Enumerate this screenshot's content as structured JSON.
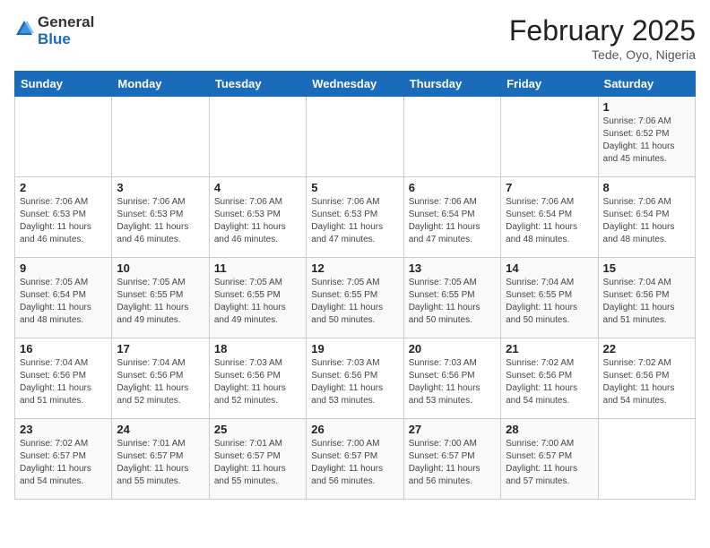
{
  "header": {
    "logo_general": "General",
    "logo_blue": "Blue",
    "month": "February 2025",
    "location": "Tede, Oyo, Nigeria"
  },
  "days_of_week": [
    "Sunday",
    "Monday",
    "Tuesday",
    "Wednesday",
    "Thursday",
    "Friday",
    "Saturday"
  ],
  "weeks": [
    [
      {
        "day": "",
        "info": ""
      },
      {
        "day": "",
        "info": ""
      },
      {
        "day": "",
        "info": ""
      },
      {
        "day": "",
        "info": ""
      },
      {
        "day": "",
        "info": ""
      },
      {
        "day": "",
        "info": ""
      },
      {
        "day": "1",
        "info": "Sunrise: 7:06 AM\nSunset: 6:52 PM\nDaylight: 11 hours and 45 minutes."
      }
    ],
    [
      {
        "day": "2",
        "info": "Sunrise: 7:06 AM\nSunset: 6:53 PM\nDaylight: 11 hours and 46 minutes."
      },
      {
        "day": "3",
        "info": "Sunrise: 7:06 AM\nSunset: 6:53 PM\nDaylight: 11 hours and 46 minutes."
      },
      {
        "day": "4",
        "info": "Sunrise: 7:06 AM\nSunset: 6:53 PM\nDaylight: 11 hours and 46 minutes."
      },
      {
        "day": "5",
        "info": "Sunrise: 7:06 AM\nSunset: 6:53 PM\nDaylight: 11 hours and 47 minutes."
      },
      {
        "day": "6",
        "info": "Sunrise: 7:06 AM\nSunset: 6:54 PM\nDaylight: 11 hours and 47 minutes."
      },
      {
        "day": "7",
        "info": "Sunrise: 7:06 AM\nSunset: 6:54 PM\nDaylight: 11 hours and 48 minutes."
      },
      {
        "day": "8",
        "info": "Sunrise: 7:06 AM\nSunset: 6:54 PM\nDaylight: 11 hours and 48 minutes."
      }
    ],
    [
      {
        "day": "9",
        "info": "Sunrise: 7:05 AM\nSunset: 6:54 PM\nDaylight: 11 hours and 48 minutes."
      },
      {
        "day": "10",
        "info": "Sunrise: 7:05 AM\nSunset: 6:55 PM\nDaylight: 11 hours and 49 minutes."
      },
      {
        "day": "11",
        "info": "Sunrise: 7:05 AM\nSunset: 6:55 PM\nDaylight: 11 hours and 49 minutes."
      },
      {
        "day": "12",
        "info": "Sunrise: 7:05 AM\nSunset: 6:55 PM\nDaylight: 11 hours and 50 minutes."
      },
      {
        "day": "13",
        "info": "Sunrise: 7:05 AM\nSunset: 6:55 PM\nDaylight: 11 hours and 50 minutes."
      },
      {
        "day": "14",
        "info": "Sunrise: 7:04 AM\nSunset: 6:55 PM\nDaylight: 11 hours and 50 minutes."
      },
      {
        "day": "15",
        "info": "Sunrise: 7:04 AM\nSunset: 6:56 PM\nDaylight: 11 hours and 51 minutes."
      }
    ],
    [
      {
        "day": "16",
        "info": "Sunrise: 7:04 AM\nSunset: 6:56 PM\nDaylight: 11 hours and 51 minutes."
      },
      {
        "day": "17",
        "info": "Sunrise: 7:04 AM\nSunset: 6:56 PM\nDaylight: 11 hours and 52 minutes."
      },
      {
        "day": "18",
        "info": "Sunrise: 7:03 AM\nSunset: 6:56 PM\nDaylight: 11 hours and 52 minutes."
      },
      {
        "day": "19",
        "info": "Sunrise: 7:03 AM\nSunset: 6:56 PM\nDaylight: 11 hours and 53 minutes."
      },
      {
        "day": "20",
        "info": "Sunrise: 7:03 AM\nSunset: 6:56 PM\nDaylight: 11 hours and 53 minutes."
      },
      {
        "day": "21",
        "info": "Sunrise: 7:02 AM\nSunset: 6:56 PM\nDaylight: 11 hours and 54 minutes."
      },
      {
        "day": "22",
        "info": "Sunrise: 7:02 AM\nSunset: 6:56 PM\nDaylight: 11 hours and 54 minutes."
      }
    ],
    [
      {
        "day": "23",
        "info": "Sunrise: 7:02 AM\nSunset: 6:57 PM\nDaylight: 11 hours and 54 minutes."
      },
      {
        "day": "24",
        "info": "Sunrise: 7:01 AM\nSunset: 6:57 PM\nDaylight: 11 hours and 55 minutes."
      },
      {
        "day": "25",
        "info": "Sunrise: 7:01 AM\nSunset: 6:57 PM\nDaylight: 11 hours and 55 minutes."
      },
      {
        "day": "26",
        "info": "Sunrise: 7:00 AM\nSunset: 6:57 PM\nDaylight: 11 hours and 56 minutes."
      },
      {
        "day": "27",
        "info": "Sunrise: 7:00 AM\nSunset: 6:57 PM\nDaylight: 11 hours and 56 minutes."
      },
      {
        "day": "28",
        "info": "Sunrise: 7:00 AM\nSunset: 6:57 PM\nDaylight: 11 hours and 57 minutes."
      },
      {
        "day": "",
        "info": ""
      }
    ]
  ]
}
